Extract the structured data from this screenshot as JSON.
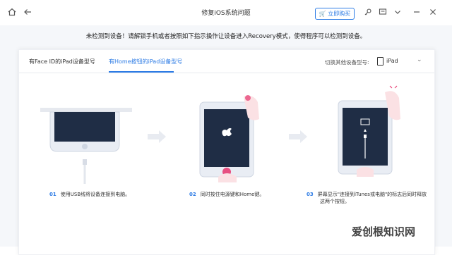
{
  "window": {
    "title": "修复iOS系统问题",
    "buy_label": "立即购买",
    "icons": [
      "home-icon",
      "back-icon",
      "key-icon",
      "feedback-icon",
      "chevron-down-icon",
      "minimize-icon",
      "close-icon"
    ]
  },
  "notice": "未检测到设备！请解锁手机或者按照如下指示操作让设备进入Recovery模式，使得程序可以检测到设备。",
  "tabs": [
    {
      "label": "有Face ID的iPad设备型号",
      "active": false
    },
    {
      "label": "有Home按钮的iPad设备型号",
      "active": true
    }
  ],
  "device_selector": {
    "label": "切换其他设备型号:",
    "value": "iPad"
  },
  "steps": [
    {
      "num": "01",
      "text": "使用USB线将设备连接到电脑。"
    },
    {
      "num": "02",
      "text": "同时按住电源键和Home键。"
    },
    {
      "num": "03",
      "line1": "屏幕显示\"连接到iTunes或电脑\"的标志后同时释放",
      "line2": "这两个按钮。"
    }
  ],
  "watermark": "爱创根知识网",
  "colors": {
    "accent": "#2c7be5",
    "screen": "#1f2d45",
    "device": "#e9edf4"
  }
}
